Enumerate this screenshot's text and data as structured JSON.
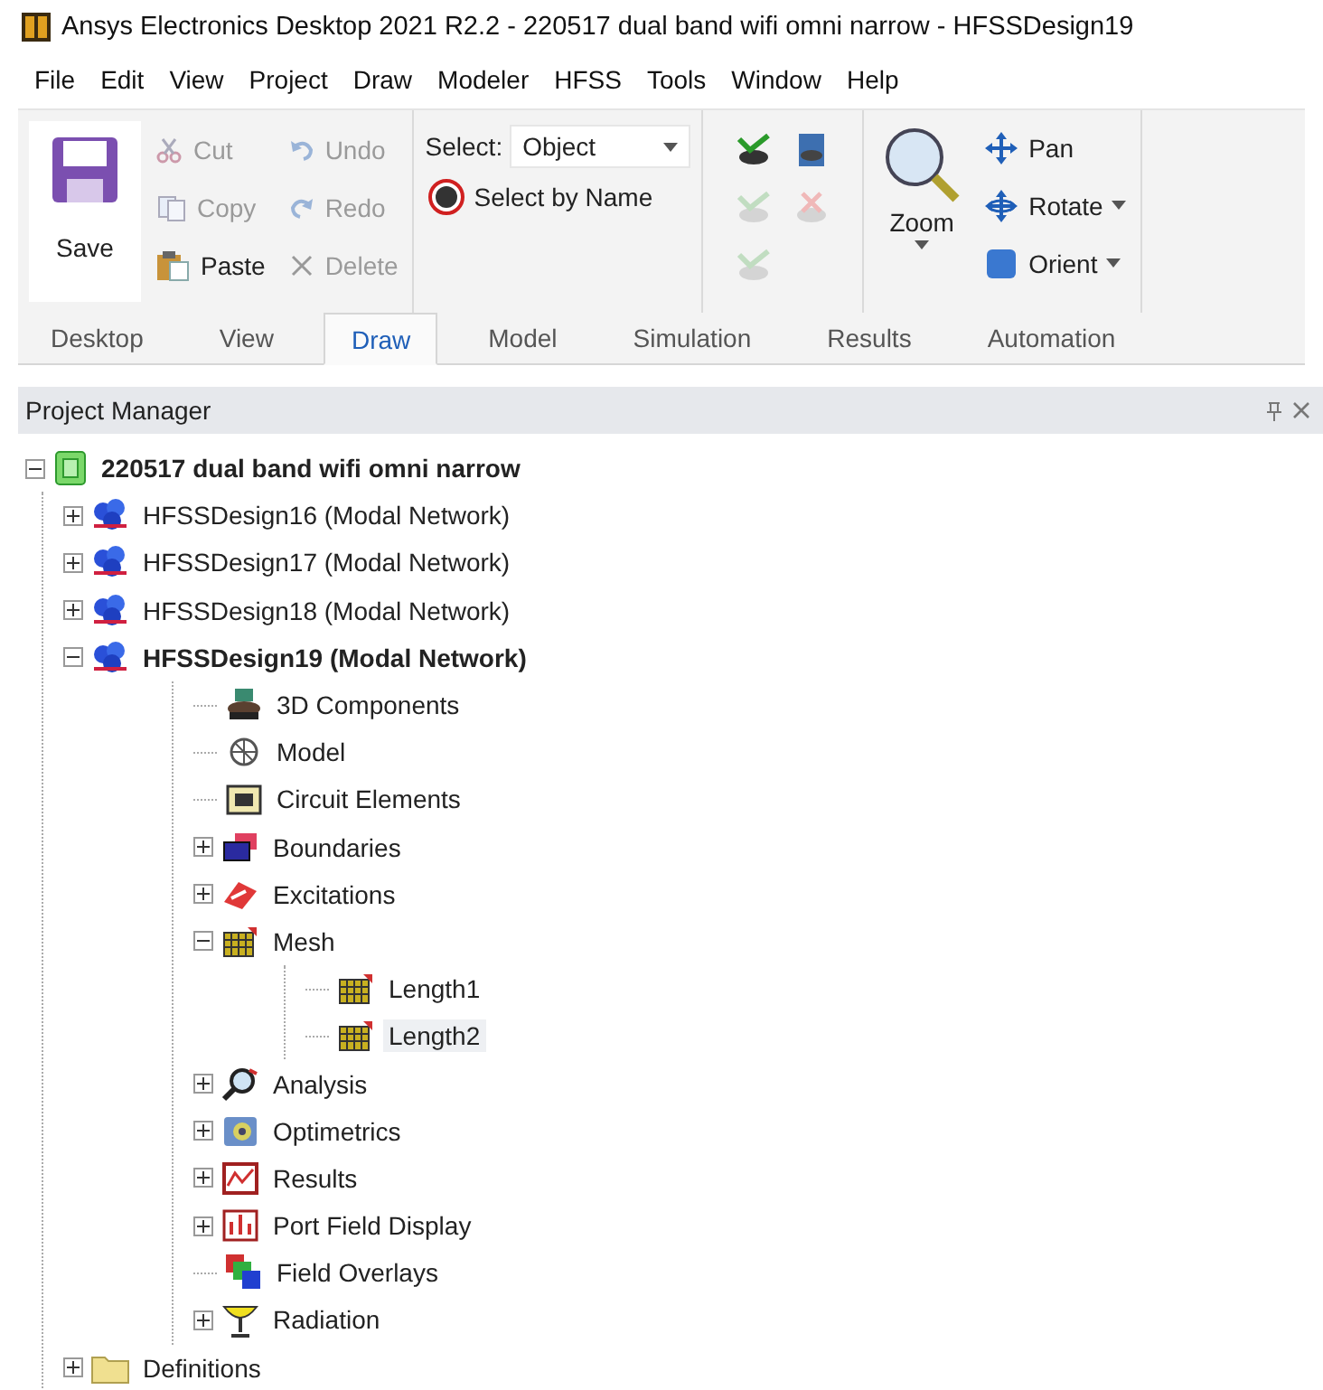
{
  "window": {
    "title": "Ansys Electronics Desktop 2021 R2.2 - 220517 dual band wifi omni narrow - HFSSDesign19"
  },
  "menu": [
    "File",
    "Edit",
    "View",
    "Project",
    "Draw",
    "Modeler",
    "HFSS",
    "Tools",
    "Window",
    "Help"
  ],
  "ribbon": {
    "save": {
      "label": "Save"
    },
    "edit_buttons": [
      {
        "kind": "cut",
        "label": "Cut",
        "disabled": true
      },
      {
        "kind": "undo",
        "label": "Undo",
        "disabled": true
      },
      {
        "kind": "copy",
        "label": "Copy",
        "disabled": true
      },
      {
        "kind": "redo",
        "label": "Redo",
        "disabled": true
      },
      {
        "kind": "paste",
        "label": "Paste",
        "disabled": false
      },
      {
        "kind": "delete",
        "label": "Delete",
        "disabled": true
      }
    ],
    "select": {
      "label": "Select:",
      "value": "Object"
    },
    "select_by_name": {
      "label": "Select by Name"
    },
    "view_buttons": [
      {
        "kind": "show",
        "disabled": false
      },
      {
        "kind": "view",
        "disabled": false
      },
      {
        "kind": "show",
        "disabled": true
      },
      {
        "kind": "hide",
        "disabled": true
      },
      {
        "kind": "show",
        "disabled": true
      }
    ],
    "zoom": {
      "label": "Zoom"
    },
    "nav_buttons": [
      {
        "kind": "pan",
        "label": "Pan",
        "dropdown": false
      },
      {
        "kind": "rotate",
        "label": "Rotate",
        "dropdown": true
      },
      {
        "kind": "orient",
        "label": "Orient",
        "dropdown": true
      }
    ]
  },
  "tabs": [
    {
      "label": "Desktop",
      "selected": false
    },
    {
      "label": "View",
      "selected": false
    },
    {
      "label": "Draw",
      "selected": true
    },
    {
      "label": "Model",
      "selected": false
    },
    {
      "label": "Simulation",
      "selected": false
    },
    {
      "label": "Results",
      "selected": false
    },
    {
      "label": "Automation",
      "selected": false
    }
  ],
  "project_manager": {
    "title": "Project Manager",
    "tree": [
      {
        "kind": "project",
        "label": "220517 dual band wifi omni narrow",
        "bold": true,
        "expanded": true,
        "children": [
          {
            "kind": "design",
            "label": "HFSSDesign16 (Modal Network)",
            "bold": false,
            "expanded": false
          },
          {
            "kind": "design",
            "label": "HFSSDesign17 (Modal Network)",
            "bold": false,
            "expanded": false
          },
          {
            "kind": "design",
            "label": "HFSSDesign18 (Modal Network)",
            "bold": false,
            "expanded": false
          },
          {
            "kind": "design",
            "label": "HFSSDesign19 (Modal Network)",
            "bold": true,
            "expanded": true,
            "children": [
              {
                "kind": "components",
                "label": "3D Components",
                "bold": false
              },
              {
                "kind": "model",
                "label": "Model",
                "bold": false
              },
              {
                "kind": "circuit",
                "label": "Circuit Elements",
                "bold": false
              },
              {
                "kind": "boundaries",
                "label": "Boundaries",
                "bold": false,
                "expanded": false
              },
              {
                "kind": "excitations",
                "label": "Excitations",
                "bold": false,
                "expanded": false
              },
              {
                "kind": "mesh",
                "label": "Mesh",
                "bold": false,
                "expanded": true,
                "children": [
                  {
                    "kind": "mesh",
                    "label": "Length1",
                    "bold": false,
                    "selected": false
                  },
                  {
                    "kind": "mesh",
                    "label": "Length2",
                    "bold": false,
                    "selected": true
                  }
                ]
              },
              {
                "kind": "analysis",
                "label": "Analysis",
                "bold": false,
                "expanded": false
              },
              {
                "kind": "optimetrics",
                "label": "Optimetrics",
                "bold": false,
                "expanded": false
              },
              {
                "kind": "results",
                "label": "Results",
                "bold": false,
                "expanded": false
              },
              {
                "kind": "portfield",
                "label": "Port Field Display",
                "bold": false,
                "expanded": false
              },
              {
                "kind": "overlays",
                "label": "Field Overlays",
                "bold": false
              },
              {
                "kind": "radiation",
                "label": "Radiation",
                "bold": false,
                "expanded": false
              }
            ]
          },
          {
            "kind": "folder",
            "label": "Definitions",
            "bold": false,
            "expanded": false
          }
        ]
      }
    ]
  }
}
